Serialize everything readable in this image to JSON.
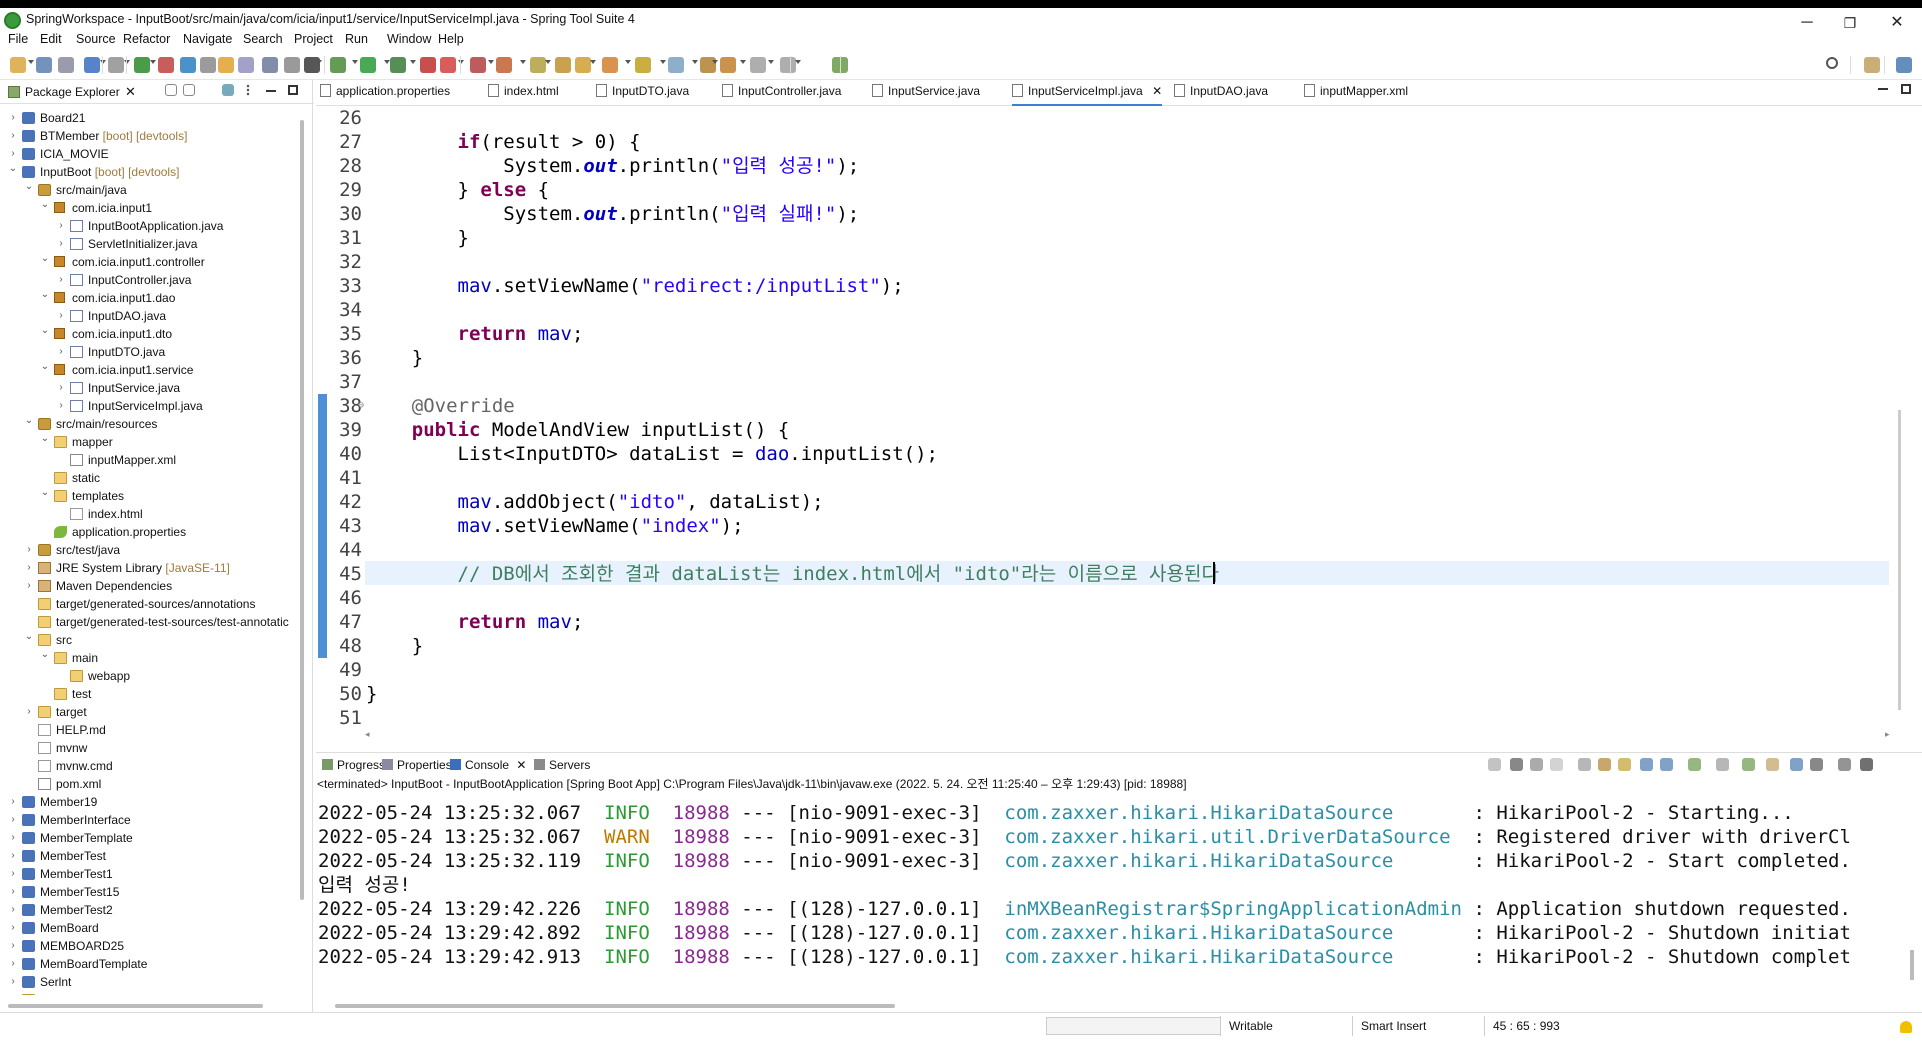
{
  "window": {
    "title": "SpringWorkspace - InputBoot/src/main/java/com/icia/input1/service/InputServiceImpl.java - Spring Tool Suite 4",
    "minimize": "─",
    "maximize": "❐",
    "close": "✕"
  },
  "menu": [
    "File",
    "Edit",
    "Source",
    "Refactor",
    "Navigate",
    "Search",
    "Project",
    "Run",
    "Window",
    "Help"
  ],
  "package_explorer": {
    "title": "Package Explorer",
    "close": "✕",
    "rows": [
      {
        "t": "Board21",
        "d": "",
        "icon": "proj",
        "lv": 0,
        "tw": "›"
      },
      {
        "t": "BTMember",
        "d": "[boot] [devtools]",
        "icon": "proj",
        "lv": 0,
        "tw": "›"
      },
      {
        "t": "ICIA_MOVIE",
        "d": "",
        "icon": "proj",
        "lv": 0,
        "tw": "›"
      },
      {
        "t": "InputBoot",
        "d": "[boot] [devtools]",
        "icon": "proj",
        "lv": 0,
        "tw": "⌄"
      },
      {
        "t": "src/main/java",
        "d": "",
        "icon": "src",
        "lv": 1,
        "tw": "⌄"
      },
      {
        "t": "com.icia.input1",
        "d": "",
        "icon": "pkg",
        "lv": 2,
        "tw": "⌄"
      },
      {
        "t": "InputBootApplication.java",
        "d": "",
        "icon": "java",
        "lv": 3,
        "tw": "›"
      },
      {
        "t": "ServletInitializer.java",
        "d": "",
        "icon": "java",
        "lv": 3,
        "tw": "›"
      },
      {
        "t": "com.icia.input1.controller",
        "d": "",
        "icon": "pkg",
        "lv": 2,
        "tw": "⌄"
      },
      {
        "t": "InputController.java",
        "d": "",
        "icon": "java",
        "lv": 3,
        "tw": "›"
      },
      {
        "t": "com.icia.input1.dao",
        "d": "",
        "icon": "pkg",
        "lv": 2,
        "tw": "⌄"
      },
      {
        "t": "InputDAO.java",
        "d": "",
        "icon": "java",
        "lv": 3,
        "tw": "›"
      },
      {
        "t": "com.icia.input1.dto",
        "d": "",
        "icon": "pkg",
        "lv": 2,
        "tw": "⌄"
      },
      {
        "t": "InputDTO.java",
        "d": "",
        "icon": "java",
        "lv": 3,
        "tw": "›"
      },
      {
        "t": "com.icia.input1.service",
        "d": "",
        "icon": "pkg",
        "lv": 2,
        "tw": "⌄"
      },
      {
        "t": "InputService.java",
        "d": "",
        "icon": "java",
        "lv": 3,
        "tw": "›"
      },
      {
        "t": "InputServiceImpl.java",
        "d": "",
        "icon": "java",
        "lv": 3,
        "tw": "›"
      },
      {
        "t": "src/main/resources",
        "d": "",
        "icon": "src",
        "lv": 1,
        "tw": "⌄"
      },
      {
        "t": "mapper",
        "d": "",
        "icon": "folder",
        "lv": 2,
        "tw": "⌄"
      },
      {
        "t": "inputMapper.xml",
        "d": "",
        "icon": "xml",
        "lv": 3,
        "tw": ""
      },
      {
        "t": "static",
        "d": "",
        "icon": "folder",
        "lv": 2,
        "tw": ""
      },
      {
        "t": "templates",
        "d": "",
        "icon": "folder",
        "lv": 2,
        "tw": "⌄"
      },
      {
        "t": "index.html",
        "d": "",
        "icon": "file",
        "lv": 3,
        "tw": ""
      },
      {
        "t": "application.properties",
        "d": "",
        "icon": "leaf",
        "lv": 2,
        "tw": ""
      },
      {
        "t": "src/test/java",
        "d": "",
        "icon": "src",
        "lv": 1,
        "tw": "›"
      },
      {
        "t": "JRE System Library",
        "d": "[JavaSE-11]",
        "icon": "lib",
        "lv": 1,
        "tw": "›"
      },
      {
        "t": "Maven Dependencies",
        "d": "",
        "icon": "lib",
        "lv": 1,
        "tw": "›"
      },
      {
        "t": "target/generated-sources/annotations",
        "d": "",
        "icon": "folder",
        "lv": 1,
        "tw": ""
      },
      {
        "t": "target/generated-test-sources/test-annotatic",
        "d": "",
        "icon": "folder",
        "lv": 1,
        "tw": ""
      },
      {
        "t": "src",
        "d": "",
        "icon": "folder",
        "lv": 1,
        "tw": "⌄"
      },
      {
        "t": "main",
        "d": "",
        "icon": "folder",
        "lv": 2,
        "tw": "⌄"
      },
      {
        "t": "webapp",
        "d": "",
        "icon": "folder",
        "lv": 3,
        "tw": ""
      },
      {
        "t": "test",
        "d": "",
        "icon": "folder",
        "lv": 2,
        "tw": ""
      },
      {
        "t": "target",
        "d": "",
        "icon": "folder",
        "lv": 1,
        "tw": "›"
      },
      {
        "t": "HELP.md",
        "d": "",
        "icon": "file",
        "lv": 1,
        "tw": ""
      },
      {
        "t": "mvnw",
        "d": "",
        "icon": "file",
        "lv": 1,
        "tw": ""
      },
      {
        "t": "mvnw.cmd",
        "d": "",
        "icon": "file",
        "lv": 1,
        "tw": ""
      },
      {
        "t": "pom.xml",
        "d": "",
        "icon": "xml",
        "lv": 1,
        "tw": ""
      },
      {
        "t": "Member19",
        "d": "",
        "icon": "proj",
        "lv": 0,
        "tw": "›"
      },
      {
        "t": "MemberInterface",
        "d": "",
        "icon": "proj",
        "lv": 0,
        "tw": "›"
      },
      {
        "t": "MemberTemplate",
        "d": "",
        "icon": "proj",
        "lv": 0,
        "tw": "›"
      },
      {
        "t": "MemberTest",
        "d": "",
        "icon": "proj",
        "lv": 0,
        "tw": "›"
      },
      {
        "t": "MemberTest1",
        "d": "",
        "icon": "proj",
        "lv": 0,
        "tw": "›"
      },
      {
        "t": "MemberTest15",
        "d": "",
        "icon": "proj",
        "lv": 0,
        "tw": "›"
      },
      {
        "t": "MemberTest2",
        "d": "",
        "icon": "proj",
        "lv": 0,
        "tw": "›"
      },
      {
        "t": "MemBoard",
        "d": "",
        "icon": "proj",
        "lv": 0,
        "tw": "›"
      },
      {
        "t": "MEMBOARD25",
        "d": "",
        "icon": "proj",
        "lv": 0,
        "tw": "›"
      },
      {
        "t": "MemBoardTemplate",
        "d": "",
        "icon": "proj",
        "lv": 0,
        "tw": "›"
      },
      {
        "t": "Serlnt",
        "d": "",
        "icon": "proj",
        "lv": 0,
        "tw": "›"
      },
      {
        "t": "Servers",
        "d": "",
        "icon": "folder",
        "lv": 0,
        "tw": "›"
      }
    ]
  },
  "editor_tabs": [
    {
      "label": "application.properties",
      "active": false
    },
    {
      "label": "index.html",
      "active": false
    },
    {
      "label": "InputDTO.java",
      "active": false
    },
    {
      "label": "InputController.java",
      "active": false
    },
    {
      "label": "InputService.java",
      "active": false
    },
    {
      "label": "InputServiceImpl.java",
      "active": true
    },
    {
      "label": "InputDAO.java",
      "active": false
    },
    {
      "label": "inputMapper.xml",
      "active": false
    }
  ],
  "editor_lines": [
    {
      "n": "26",
      "tokens": []
    },
    {
      "n": "27",
      "tokens": [
        [
          "",
          "        "
        ],
        [
          "kw",
          "if"
        ],
        [
          "",
          "(result > 0) {"
        ]
      ]
    },
    {
      "n": "28",
      "tokens": [
        [
          "",
          "            System."
        ],
        [
          "sfld",
          "out"
        ],
        [
          "",
          ".println("
        ],
        [
          "str",
          "\"입력 성공!\""
        ],
        [
          "",
          ");"
        ]
      ]
    },
    {
      "n": "29",
      "tokens": [
        [
          "",
          "        } "
        ],
        [
          "kw",
          "else"
        ],
        [
          "",
          " {"
        ]
      ]
    },
    {
      "n": "30",
      "tokens": [
        [
          "",
          "            System."
        ],
        [
          "sfld",
          "out"
        ],
        [
          "",
          ".println("
        ],
        [
          "str",
          "\"입력 실패!\""
        ],
        [
          "",
          ");"
        ]
      ]
    },
    {
      "n": "31",
      "tokens": [
        [
          "",
          "        }"
        ]
      ]
    },
    {
      "n": "32",
      "tokens": []
    },
    {
      "n": "33",
      "tokens": [
        [
          "",
          "        "
        ],
        [
          "fld",
          "mav"
        ],
        [
          "",
          ".setViewName("
        ],
        [
          "str",
          "\"redirect:/inputList\""
        ],
        [
          "",
          ");"
        ]
      ]
    },
    {
      "n": "34",
      "tokens": []
    },
    {
      "n": "35",
      "tokens": [
        [
          "",
          "        "
        ],
        [
          "kw",
          "return"
        ],
        [
          "",
          " "
        ],
        [
          "fld",
          "mav"
        ],
        [
          "",
          ";"
        ]
      ]
    },
    {
      "n": "36",
      "tokens": [
        [
          "",
          "    }"
        ]
      ]
    },
    {
      "n": "37",
      "tokens": []
    },
    {
      "n": "38",
      "tokens": [
        [
          "",
          "    "
        ],
        [
          "ann",
          "@Override"
        ]
      ]
    },
    {
      "n": "39",
      "tokens": [
        [
          "",
          "    "
        ],
        [
          "kw",
          "public"
        ],
        [
          "",
          " ModelAndView inputList() {"
        ]
      ]
    },
    {
      "n": "40",
      "tokens": [
        [
          "",
          "        List<InputDTO> dataList = "
        ],
        [
          "fld",
          "dao"
        ],
        [
          "",
          ".inputList();"
        ]
      ]
    },
    {
      "n": "41",
      "tokens": []
    },
    {
      "n": "42",
      "tokens": [
        [
          "",
          "        "
        ],
        [
          "fld",
          "mav"
        ],
        [
          "",
          ".addObject("
        ],
        [
          "str",
          "\"idto\""
        ],
        [
          "",
          ", dataList);"
        ]
      ]
    },
    {
      "n": "43",
      "tokens": [
        [
          "",
          "        "
        ],
        [
          "fld",
          "mav"
        ],
        [
          "",
          ".setViewName("
        ],
        [
          "str",
          "\"index\""
        ],
        [
          "",
          ");"
        ]
      ]
    },
    {
      "n": "44",
      "tokens": []
    },
    {
      "n": "45",
      "tokens": [
        [
          "",
          "        "
        ],
        [
          "cmt",
          "// DB에서 조회한 결과 dataList는 index.html에서 \"idto\"라는 이름으로 사용된다"
        ]
      ]
    },
    {
      "n": "46",
      "tokens": []
    },
    {
      "n": "47",
      "tokens": [
        [
          "",
          "        "
        ],
        [
          "kw",
          "return"
        ],
        [
          "",
          " "
        ],
        [
          "fld",
          "mav"
        ],
        [
          "",
          ";"
        ]
      ]
    },
    {
      "n": "48",
      "tokens": [
        [
          "",
          "    }"
        ]
      ]
    },
    {
      "n": "49",
      "tokens": []
    },
    {
      "n": "50",
      "tokens": [
        [
          "",
          "}"
        ]
      ]
    },
    {
      "n": "51",
      "tokens": []
    }
  ],
  "bottom_tabs": [
    {
      "label": "Progress"
    },
    {
      "label": "Properties"
    },
    {
      "label": "Console",
      "active": true
    },
    {
      "label": "Servers"
    }
  ],
  "console_status": "<terminated> InputBoot - InputBootApplication [Spring Boot App] C:\\Program Files\\Java\\jdk-11\\bin\\javaw.exe  (2022. 5. 24. 오전 11:25:40 – 오후 1:29:43) [pid: 18988]",
  "console_lines": [
    {
      "ts": "2022-05-24 13:25:32.067",
      "lvl": "INFO",
      "pid": "18988",
      "th": "[nio-9091-exec-3]",
      "lg": "com.zaxxer.hikari.HikariDataSource      ",
      "msg": ": HikariPool-2 - Starting..."
    },
    {
      "ts": "2022-05-24 13:25:32.067",
      "lvl": "WARN",
      "pid": "18988",
      "th": "[nio-9091-exec-3]",
      "lg": "com.zaxxer.hikari.util.DriverDataSource ",
      "msg": ": Registered driver with driverCl"
    },
    {
      "ts": "2022-05-24 13:25:32.119",
      "lvl": "INFO",
      "pid": "18988",
      "th": "[nio-9091-exec-3]",
      "lg": "com.zaxxer.hikari.HikariDataSource      ",
      "msg": ": HikariPool-2 - Start completed."
    },
    {
      "plain": "입력 성공!"
    },
    {
      "ts": "2022-05-24 13:29:42.226",
      "lvl": "INFO",
      "pid": "18988",
      "th": "[(128)-127.0.0.1]",
      "lg": "inMXBeanRegistrar$SpringApplicationAdmin",
      "msg": ": Application shutdown requested."
    },
    {
      "ts": "2022-05-24 13:29:42.892",
      "lvl": "INFO",
      "pid": "18988",
      "th": "[(128)-127.0.0.1]",
      "lg": "com.zaxxer.hikari.HikariDataSource      ",
      "msg": ": HikariPool-2 - Shutdown initiat"
    },
    {
      "ts": "2022-05-24 13:29:42.913",
      "lvl": "INFO",
      "pid": "18988",
      "th": "[(128)-127.0.0.1]",
      "lg": "com.zaxxer.hikari.HikariDataSource      ",
      "msg": ": HikariPool-2 - Shutdown complet"
    }
  ],
  "status": {
    "writable": "Writable",
    "insert_mode": "Smart Insert",
    "position": "45 : 65 : 993"
  }
}
